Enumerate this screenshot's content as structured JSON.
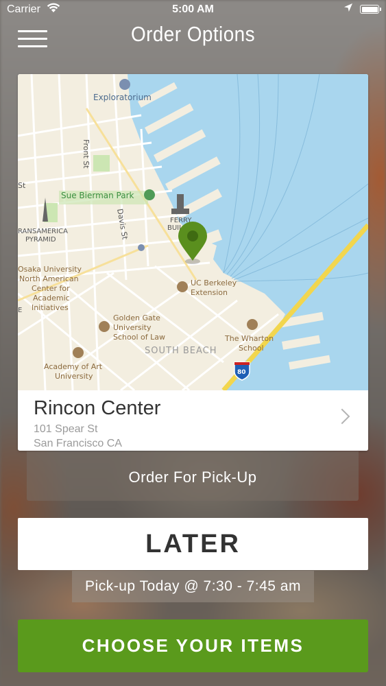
{
  "status_bar": {
    "carrier": "Carrier",
    "time": "5:00 AM"
  },
  "header": {
    "title": "Order Options",
    "menu_icon": "hamburger-menu-icon"
  },
  "map": {
    "labels": {
      "exploratorium": "Exploratorium",
      "front_st": "Front St",
      "sue_bierman": "Sue Bierman Park",
      "davis_st": "Davis St",
      "st": "St",
      "ferry_building_1": "FERRY",
      "ferry_building_2": "BUILDING",
      "transamerica_1": "RANSAMERICA",
      "transamerica_2": "PYRAMID",
      "osaka_1": "Osaka University",
      "osaka_2": "North American",
      "osaka_3": "Center for",
      "osaka_4": "Academic",
      "osaka_5": "Initiatives",
      "ucb_1": "UC Berkeley",
      "ucb_2": "Extension",
      "ggu_1": "Golden Gate",
      "ggu_2": "University",
      "ggu_3": "School of Law",
      "wharton_1": "The Wharton",
      "wharton_2": "School",
      "south_beach": "SOUTH BEACH",
      "academy_1": "Academy of Art",
      "academy_2": "University",
      "interstate": "80",
      "edge_e": "E"
    },
    "colors": {
      "water": "#a9d6ee",
      "land": "#f3eee0",
      "pin": "#5a8f1e",
      "highway": "#f2d64e"
    }
  },
  "location": {
    "name": "Rincon Center",
    "address_line1": "101 Spear St",
    "address_line2": "San Francisco CA"
  },
  "order_mode": "Order For Pick-Up",
  "later_label": "LATER",
  "pickup_time": "Pick-up Today @ 7:30 - 7:45 am",
  "cta_label": "CHOOSE YOUR ITEMS",
  "colors": {
    "cta": "#5a9a1c"
  }
}
